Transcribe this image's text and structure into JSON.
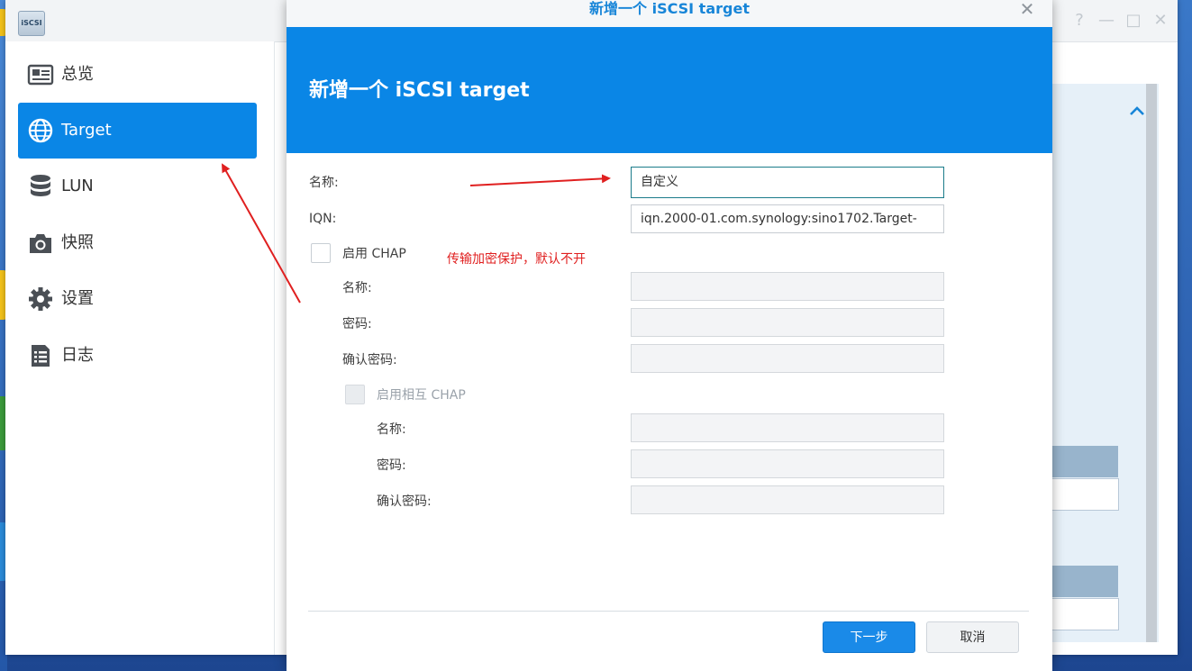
{
  "app": {
    "icon_label": "iSCSI",
    "sidebar": {
      "items": [
        {
          "label": "总览",
          "icon": "overview-icon",
          "active": false
        },
        {
          "label": "Target",
          "icon": "globe-icon",
          "active": true
        },
        {
          "label": "LUN",
          "icon": "database-icon",
          "active": false
        },
        {
          "label": "快照",
          "icon": "camera-icon",
          "active": false
        },
        {
          "label": "设置",
          "icon": "gear-icon",
          "active": false
        },
        {
          "label": "日志",
          "icon": "log-icon",
          "active": false
        }
      ]
    }
  },
  "dialog": {
    "title": "新增一个 iSCSI target",
    "heading": "新增一个 iSCSI target",
    "close_icon": "close-icon",
    "name_label": "名称:",
    "name_value": "自定义",
    "iqn_label": "IQN:",
    "iqn_value": "iqn.2000-01.com.synology:sino1702.Target-",
    "chap_label": "启用 CHAP",
    "chap_name_label": "名称:",
    "chap_password_label": "密码:",
    "chap_confirm_label": "确认密码:",
    "mutual_chap_label": "启用相互 CHAP",
    "mutual_name_label": "名称:",
    "mutual_password_label": "密码:",
    "mutual_confirm_label": "确认密码:",
    "next_button": "下一步",
    "cancel_button": "取消"
  },
  "annotation": {
    "text": "传输加密保护，默认不开",
    "color": "#e02020"
  },
  "colors": {
    "accent": "#0a86e6",
    "annotation_red": "#e02020"
  }
}
